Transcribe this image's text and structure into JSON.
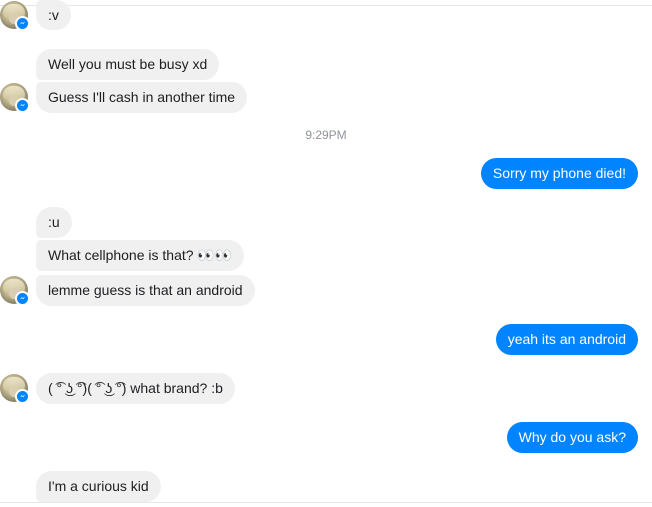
{
  "conversation": {
    "timestamp": "9:29PM",
    "messages": [
      {
        "id": "m1",
        "side": "incoming",
        "text": ":v"
      },
      {
        "id": "m2",
        "side": "incoming",
        "text": "Well you must be busy xd"
      },
      {
        "id": "m3",
        "side": "incoming",
        "text": "Guess I'll cash in another time"
      },
      {
        "id": "m4",
        "side": "outgoing",
        "text": "Sorry my phone died!"
      },
      {
        "id": "m5",
        "side": "incoming",
        "text": ":u"
      },
      {
        "id": "m6",
        "side": "incoming",
        "text": "What cellphone is that? 👀👀"
      },
      {
        "id": "m7",
        "side": "incoming",
        "text": "lemme guess is that an android"
      },
      {
        "id": "m8",
        "side": "outgoing",
        "text": "yeah its an android"
      },
      {
        "id": "m9",
        "side": "incoming",
        "text": "( ͡° ͜ʖ ͡°)( ͡° ͜ʖ ͡°) what brand? :b"
      },
      {
        "id": "m10",
        "side": "outgoing",
        "text": "Why do you ask?"
      },
      {
        "id": "m11",
        "side": "incoming",
        "text": "I'm a curious kid"
      }
    ]
  },
  "colors": {
    "outgoing_bubble": "#0084ff",
    "incoming_bubble": "#f1f0f0",
    "timestamp_text": "#90949c"
  },
  "icons": {
    "avatar": "user-avatar",
    "badge": "messenger-badge-icon"
  }
}
